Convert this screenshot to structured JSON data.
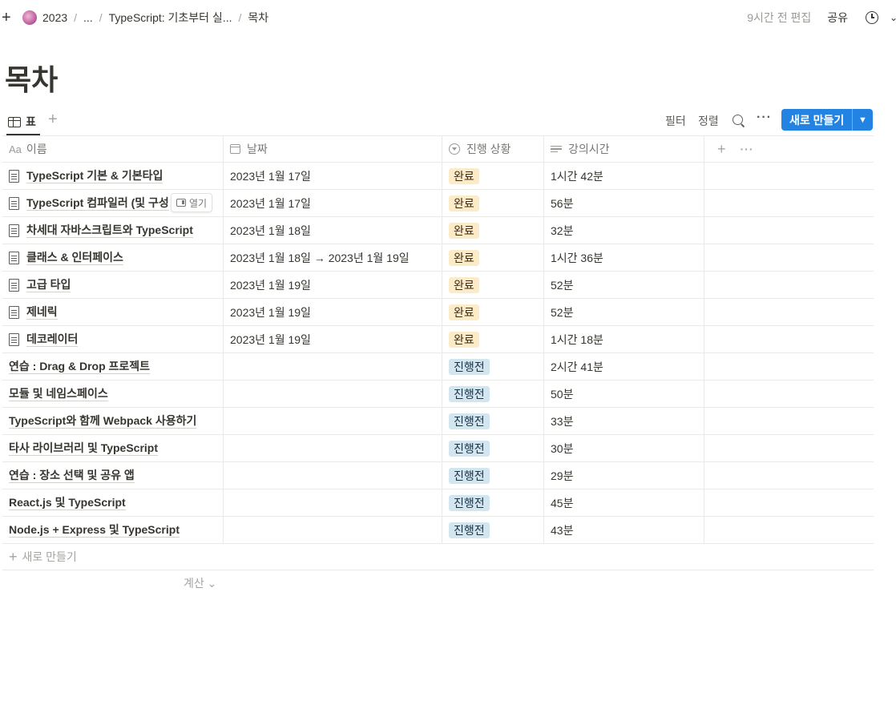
{
  "topbar": {
    "breadcrumbs": [
      "2023",
      "...",
      "TypeScript: 기초부터 실...",
      "목차"
    ],
    "edited": "9시간 전 편집",
    "share": "공유"
  },
  "page": {
    "title": "목차"
  },
  "view": {
    "tab_label": "표",
    "filter": "필터",
    "sort": "정렬",
    "new_button": "새로 만들기"
  },
  "table": {
    "columns": [
      {
        "label": "이름",
        "prefix": "Aa"
      },
      {
        "label": "날짜"
      },
      {
        "label": "진행 상황"
      },
      {
        "label": "강의시간"
      }
    ],
    "open_label": "열기",
    "rows": [
      {
        "name": "TypeScript 기본 & 기본타입",
        "date": "2023년 1월 17일",
        "status": "완료",
        "time": "1시간 42분"
      },
      {
        "name": "TypeScript 컴파일러 (및 구성",
        "date": "2023년 1월 17일",
        "status": "완료",
        "time": "56분"
      },
      {
        "name": "차세대 자바스크립트와 TypeScript",
        "date": "2023년 1월 18일",
        "status": "완료",
        "time": "32분"
      },
      {
        "name": "클래스 & 인터페이스",
        "date": "2023년 1월 18일 → 2023년 1월 19일",
        "status": "완료",
        "time": "1시간 36분"
      },
      {
        "name": "고급 타입",
        "date": "2023년 1월 19일",
        "status": "완료",
        "time": "52분"
      },
      {
        "name": "제네릭",
        "date": "2023년 1월 19일",
        "status": "완료",
        "time": "52분"
      },
      {
        "name": "데코레이터",
        "date": "2023년 1월 19일",
        "status": "완료",
        "time": "1시간 18분"
      },
      {
        "name": "연습 : Drag & Drop 프로젝트",
        "date": "",
        "status": "진행전",
        "time": "2시간 41분"
      },
      {
        "name": "모듈 및 네임스페이스",
        "date": "",
        "status": "진행전",
        "time": "50분"
      },
      {
        "name": "TypeScript와 함께 Webpack 사용하기",
        "date": "",
        "status": "진행전",
        "time": "33분"
      },
      {
        "name": "타사 라이브러리 및 TypeScript",
        "date": "",
        "status": "진행전",
        "time": "30분"
      },
      {
        "name": "연습 : 장소 선택 및 공유 앱",
        "date": "",
        "status": "진행전",
        "time": "29분"
      },
      {
        "name": "React.js 및 TypeScript",
        "date": "",
        "status": "진행전",
        "time": "45분"
      },
      {
        "name": "Node.js + Express 및 TypeScript",
        "date": "",
        "status": "진행전",
        "time": "43분"
      }
    ],
    "add_row": "새로 만들기",
    "calculate": "계산"
  },
  "colors": {
    "accent": "#2383e2",
    "tag_done_bg": "#fbecc7",
    "tag_todo_bg": "#d3e5ef"
  }
}
